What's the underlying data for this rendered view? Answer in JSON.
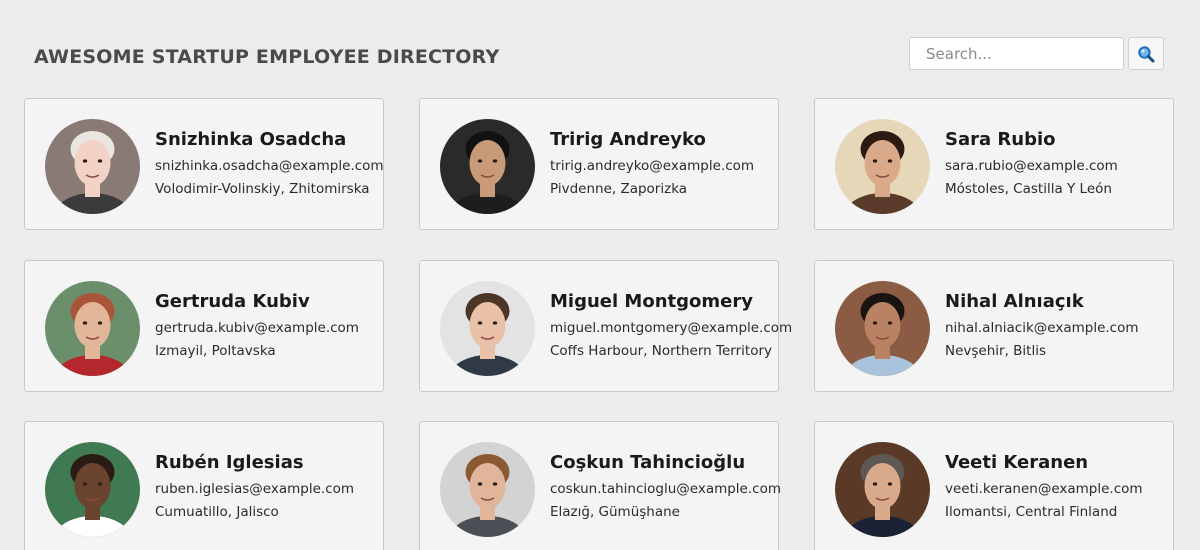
{
  "header": {
    "title": "AWESOME STARTUP EMPLOYEE DIRECTORY"
  },
  "search": {
    "placeholder": "Search...",
    "value": "",
    "button_icon": "magnifier-icon"
  },
  "colors": {
    "background": "#ececec",
    "card": "#f4f4f4",
    "card_border": "#c9c9c9",
    "search_icon": "#2b7fd0"
  },
  "employees": [
    {
      "name": "Snizhinka Osadcha",
      "email": "snizhinka.osadcha@example.com",
      "location": "Volodimir-Volinskiy, Zhitomirska",
      "avatar_bg": "#8a7a76",
      "skin": "#f1d2c4",
      "hair": "#e9e6e2",
      "shirt": "#3b3b3b"
    },
    {
      "name": "Tririg Andreyko",
      "email": "tririg.andreyko@example.com",
      "location": "Pivdenne, Zaporizka",
      "avatar_bg": "#2a2a2a",
      "skin": "#c89a78",
      "hair": "#111111",
      "shirt": "#1d1d1d"
    },
    {
      "name": "Sara Rubio",
      "email": "sara.rubio@example.com",
      "location": "Móstoles, Castilla Y León",
      "avatar_bg": "#e6d7b8",
      "skin": "#d9a98a",
      "hair": "#2a1a12",
      "shirt": "#5a3a2a"
    },
    {
      "name": "Gertruda Kubiv",
      "email": "gertruda.kubiv@example.com",
      "location": "Izmayil, Poltavska",
      "avatar_bg": "#6b8f6a",
      "skin": "#e3b699",
      "hair": "#a8553a",
      "shirt": "#b3282d"
    },
    {
      "name": "Miguel Montgomery",
      "email": "miguel.montgomery@example.com",
      "location": "Coffs Harbour, Northern Territory",
      "avatar_bg": "#e3e3e3",
      "skin": "#e8c1a8",
      "hair": "#4a3526",
      "shirt": "#2f3a46"
    },
    {
      "name": "Nihal Alnıaçık",
      "email": "nihal.alniacik@example.com",
      "location": "Nevşehir, Bitlis",
      "avatar_bg": "#8c5b44",
      "skin": "#b98363",
      "hair": "#1a1410",
      "shirt": "#a9c3dc"
    },
    {
      "name": "Rubén Iglesias",
      "email": "ruben.iglesias@example.com",
      "location": "Cumuatillo, Jalisco",
      "avatar_bg": "#3f7a52",
      "skin": "#6b4430",
      "hair": "#2a1b14",
      "shirt": "#ffffff"
    },
    {
      "name": "Coşkun Tahincioğlu",
      "email": "coskun.tahincioglu@example.com",
      "location": "Elazığ, Gümüşhane",
      "avatar_bg": "#d3d3d3",
      "skin": "#e1b59a",
      "hair": "#8a5a35",
      "shirt": "#4a4f55"
    },
    {
      "name": "Veeti Keranen",
      "email": "veeti.keranen@example.com",
      "location": "Ilomantsi, Central Finland",
      "avatar_bg": "#5a3a26",
      "skin": "#d9a98c",
      "hair": "#5e5852",
      "shirt": "#1b2236"
    }
  ]
}
